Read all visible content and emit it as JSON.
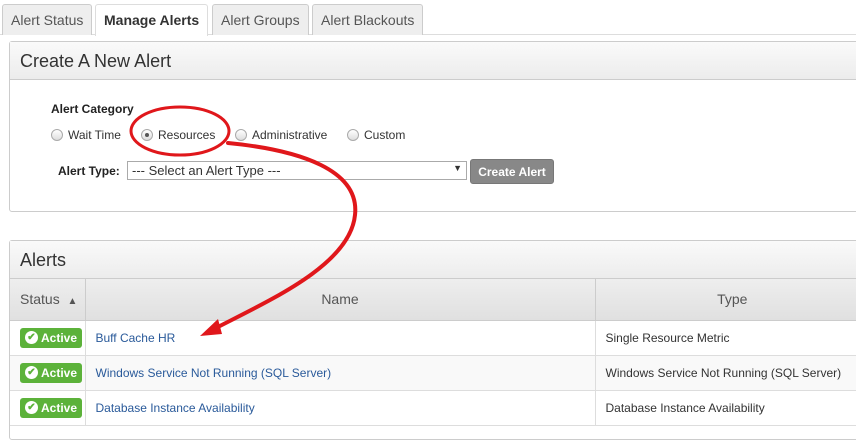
{
  "tabs": [
    "Alert Status",
    "Manage Alerts",
    "Alert Groups",
    "Alert Blackouts"
  ],
  "create": {
    "title": "Create A New Alert",
    "category_label": "Alert Category",
    "categories": [
      "Wait Time",
      "Resources",
      "Administrative",
      "Custom"
    ],
    "selected": "Resources",
    "type_label": "Alert Type:",
    "type_value": "--- Select an Alert Type ---",
    "button": "Create Alert"
  },
  "alerts": {
    "title": "Alerts",
    "columns": [
      "Status",
      "Name",
      "Type"
    ],
    "sort_indicator": "▲",
    "rows": [
      {
        "status": "Active",
        "name": "Buff Cache HR",
        "type": "Single Resource Metric"
      },
      {
        "status": "Active",
        "name": "Windows Service Not Running (SQL Server)",
        "type": "Windows Service Not Running (SQL Server)"
      },
      {
        "status": "Active",
        "name": "Database Instance Availability",
        "type": "Database Instance Availability"
      }
    ]
  },
  "colors": {
    "active": "#5cb23a",
    "annotation": "#e0171b"
  }
}
